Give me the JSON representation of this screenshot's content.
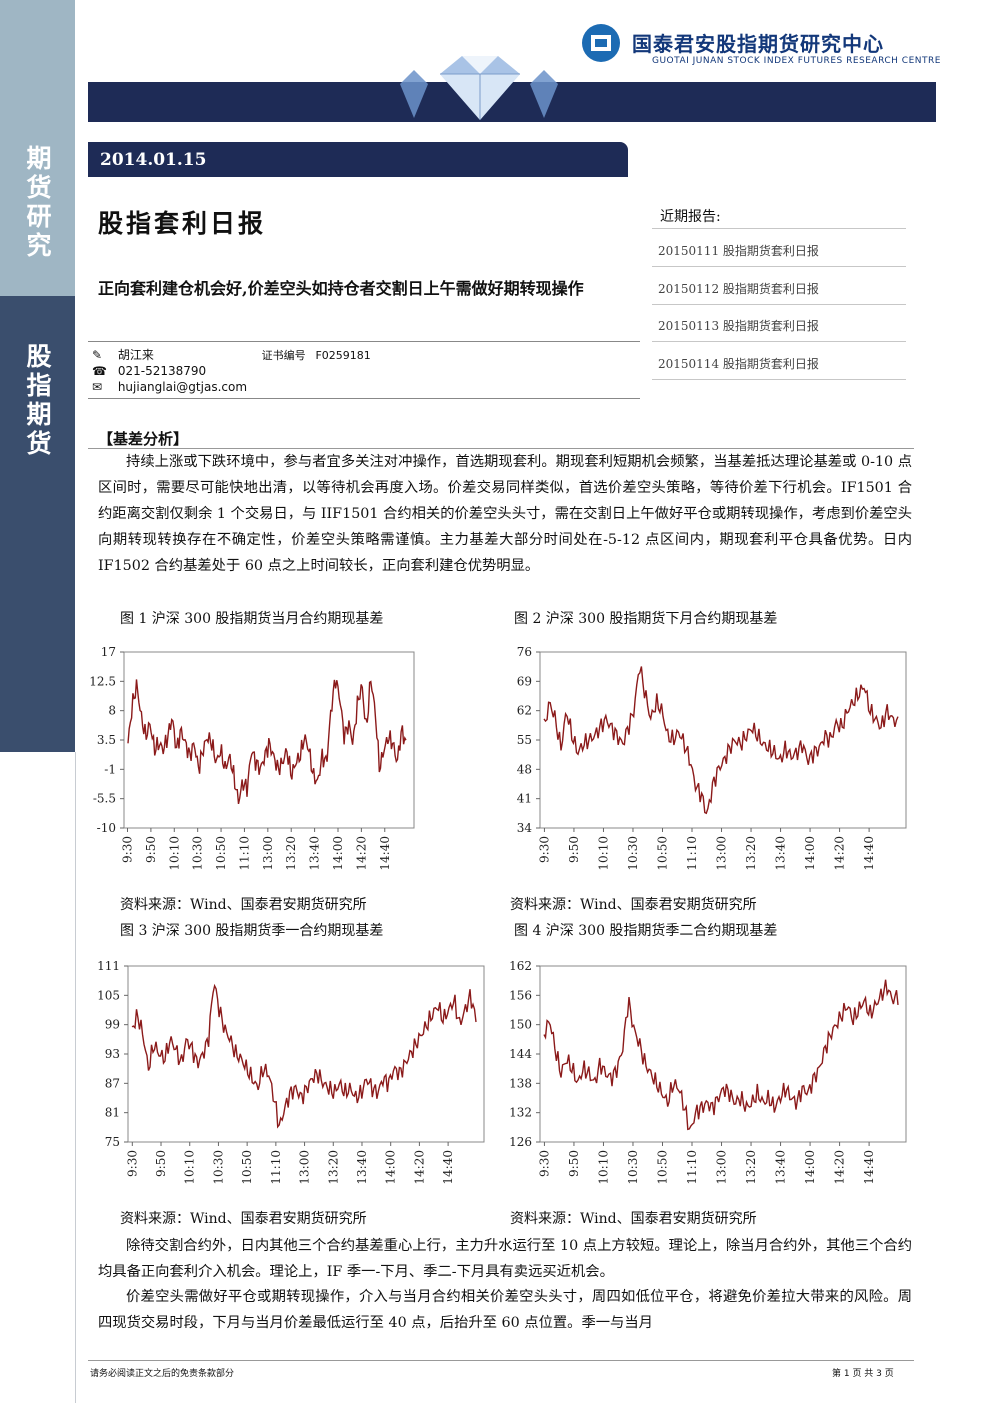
{
  "sidebar": {
    "top_label": "期货研究",
    "bottom_label": "股指期货"
  },
  "header": {
    "org_cn": "国泰君安股指期货研究中心",
    "org_en": "GUOTAI JUNAN STOCK INDEX FUTURES RESEARCH CENTRE"
  },
  "date": "2014.01.15",
  "title": "股指套利日报",
  "subtitle": "正向套利建仓机会好,价差空头如持仓者交割日上午需做好期转现操作",
  "author": {
    "name": "胡江来",
    "cert_label": "证书编号",
    "cert_no": "F0259181",
    "phone": "021-52138790",
    "email": "hujianglai@gtjas.com",
    "icons": [
      "pen-icon",
      "phone-icon",
      "mail-icon"
    ]
  },
  "recent": {
    "heading": "近期报告:",
    "items": [
      "20150111 股指期货套利日报",
      "20150112 股指期货套利日报",
      "20150113 股指期货套利日报",
      "20150114 股指期货套利日报"
    ]
  },
  "section_heading": "【基差分析】",
  "paragraphs": [
    "持续上涨或下跌环境中，参与者宜多关注对冲操作，首选期现套利。期现套利短期机会频繁，当基差抵达理论基差或 0-10 点区间时，需要尽可能快地出清，以等待机会再度入场。价差交易同样类似，首选价差空头策略，等待价差下行机会。IF1501 合约距离交割仅剩余 1 个交易日，与 IIF1501 合约相关的价差空头头寸，需在交割日上午做好平仓或期转现操作，考虑到价差空头向期转现转换存在不确定性，价差空头策略需谨慎。主力基差大部分时间处在-5-12 点区间内，期现套利平仓具备优势。日内 IF1502 合约基差处于 60 点之上时间较长，正向套利建仓优势明显。",
    "除待交割合约外，日内其他三个合约基差重心上行，主力升水运行至 10 点上方较短。理论上，除当月合约外，其他三个合约均具备正向套利介入机会。理论上，IF 季一-下月、季二-下月具有卖远买近机会。",
    "价差空头需做好平仓或期转现操作，介入与当月合约相关价差空头头寸，周四如低位平仓，将避免价差拉大带来的风险。周四现货交易时段，下月与当月价差最低运行至 40 点，后抬升至 60 点位置。季一与当月"
  ],
  "source_text": "资料来源：Wind、国泰君安期货研究所",
  "footer": {
    "left": "请务必阅读正文之后的免责条款部分",
    "right": "第 1 页 共 3 页"
  },
  "colors": {
    "navy": "#1e2b56",
    "sidebar_light": "#9fb6c4",
    "sidebar_dark": "#3a4e6d",
    "series": "#8b1a1a"
  },
  "chart_data": [
    {
      "type": "line",
      "title": "图 1 沪深 300 股指期货当月合约期现基差",
      "x_ticks": [
        "9:30",
        "9:50",
        "10:10",
        "10:30",
        "10:50",
        "11:10",
        "13:00",
        "13:20",
        "13:40",
        "14:00",
        "14:20",
        "14:40"
      ],
      "y_ticks": [
        "17",
        "12.5",
        "8",
        "3.5",
        "-1",
        "-5.5",
        "-10"
      ],
      "ylim": [
        -10,
        17
      ],
      "y_keypoints": [
        3,
        9,
        12,
        7,
        4,
        6,
        2,
        3,
        2,
        4,
        7,
        2,
        5,
        3,
        1,
        3,
        -1,
        2,
        4,
        3,
        0,
        2,
        -1,
        1,
        -2,
        -6,
        -3,
        -4,
        2,
        0,
        -1,
        1,
        3,
        1,
        -1,
        0,
        2,
        -2,
        0,
        1,
        4,
        2,
        -2,
        -3,
        1,
        0,
        8,
        13,
        10,
        4,
        6,
        3,
        9,
        12,
        5,
        13,
        8,
        -1,
        2,
        4,
        3,
        0,
        5,
        3
      ]
    },
    {
      "type": "line",
      "title": "图 2 沪深 300 股指期货下月合约期现基差",
      "x_ticks": [
        "9:30",
        "9:50",
        "10:10",
        "10:30",
        "10:50",
        "11:10",
        "13:00",
        "13:20",
        "13:40",
        "14:00",
        "14:20",
        "14:40"
      ],
      "y_ticks": [
        "76",
        "69",
        "62",
        "55",
        "48",
        "41",
        "34"
      ],
      "ylim": [
        34,
        76
      ],
      "y_keypoints": [
        58,
        64,
        60,
        53,
        62,
        56,
        52,
        54,
        55,
        56,
        58,
        60,
        58,
        56,
        54,
        58,
        62,
        73,
        66,
        60,
        64,
        62,
        56,
        55,
        57,
        54,
        50,
        44,
        42,
        37,
        44,
        48,
        50,
        53,
        55,
        54,
        56,
        58,
        56,
        54,
        53,
        52,
        50,
        53,
        51,
        52,
        54,
        50,
        52,
        53,
        56,
        55,
        59,
        58,
        62,
        64,
        66,
        68,
        62,
        60,
        58,
        62,
        60,
        59
      ]
    },
    {
      "type": "line",
      "title": "图 3 沪深 300 股指期货季一合约期现基差",
      "x_ticks": [
        "9:30",
        "9:50",
        "10:10",
        "10:30",
        "10:50",
        "11:10",
        "13:00",
        "13:20",
        "13:40",
        "14:00",
        "14:20",
        "14:40"
      ],
      "y_ticks": [
        "111",
        "105",
        "99",
        "93",
        "87",
        "81",
        "75"
      ],
      "ylim": [
        75,
        111
      ],
      "y_keypoints": [
        98,
        101,
        97,
        90,
        95,
        93,
        92,
        96,
        94,
        91,
        96,
        94,
        91,
        93,
        96,
        108,
        102,
        98,
        96,
        93,
        92,
        90,
        88,
        86,
        90,
        89,
        84,
        78,
        82,
        85,
        86,
        84,
        86,
        88,
        89,
        87,
        86,
        85,
        87,
        85,
        86,
        84,
        85,
        88,
        86,
        85,
        88,
        87,
        90,
        89,
        91,
        93,
        95,
        97,
        99,
        101,
        103,
        100,
        102,
        104,
        99,
        102,
        105,
        100
      ]
    },
    {
      "type": "line",
      "title": "图 4 沪深 300 股指期货季二合约期现基差",
      "x_ticks": [
        "9:30",
        "9:50",
        "10:10",
        "10:30",
        "10:50",
        "11:10",
        "13:00",
        "13:20",
        "13:40",
        "14:00",
        "14:20",
        "14:40"
      ],
      "y_ticks": [
        "162",
        "156",
        "150",
        "144",
        "138",
        "132",
        "126"
      ],
      "ylim": [
        126,
        162
      ],
      "y_keypoints": [
        148,
        151,
        145,
        140,
        143,
        141,
        138,
        141,
        140,
        138,
        142,
        140,
        139,
        141,
        145,
        155,
        149,
        146,
        142,
        140,
        138,
        136,
        134,
        138,
        137,
        133,
        128,
        132,
        133,
        134,
        133,
        135,
        137,
        136,
        134,
        135,
        133,
        134,
        136,
        134,
        135,
        133,
        135,
        137,
        135,
        134,
        137,
        136,
        139,
        141,
        145,
        148,
        150,
        152,
        154,
        151,
        153,
        155,
        152,
        154,
        156,
        158,
        155,
        156
      ]
    }
  ]
}
